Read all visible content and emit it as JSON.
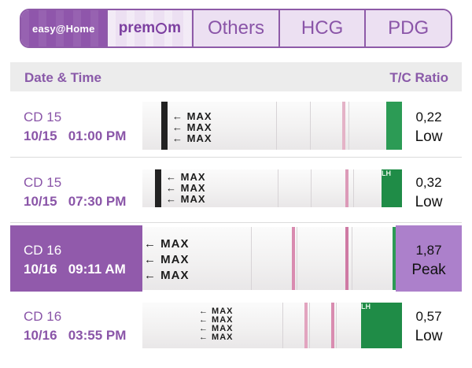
{
  "brand_tabs": {
    "easy_label": "easy@Home",
    "premom_left": "prem",
    "premom_right": "m",
    "others": "Others",
    "hcg": "HCG",
    "pdg": "PDG"
  },
  "header": {
    "date_time": "Date & Time",
    "tc_ratio": "T/C Ratio"
  },
  "rows": [
    {
      "cd": "CD 15",
      "datetime": "10/15   01:00 PM",
      "ratio": "0,22",
      "level": "Low",
      "selected": false
    },
    {
      "cd": "CD 15",
      "datetime": "10/15   07:30 PM",
      "ratio": "0,32",
      "level": "Low",
      "selected": false
    },
    {
      "cd": "CD 16",
      "datetime": "10/16   09:11 AM",
      "ratio": "1,87",
      "level": "Peak",
      "selected": true
    },
    {
      "cd": "CD 16",
      "datetime": "10/16   03:55 PM",
      "ratio": "0,57",
      "level": "Low",
      "selected": false
    }
  ],
  "strip": {
    "max_text": "← MAX",
    "lh_text": "LH"
  },
  "colors": {
    "accent": "#8f56ab",
    "selected_ratio_bg": "#ac80cb",
    "test_line": "#d07a9f",
    "control_green": "#2c9b55"
  }
}
